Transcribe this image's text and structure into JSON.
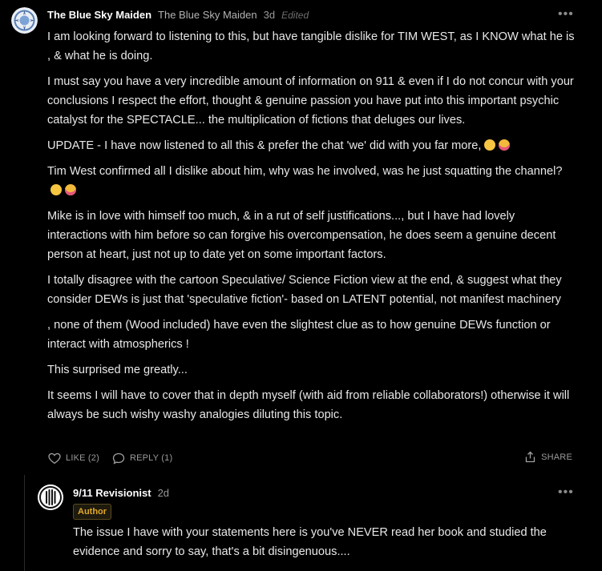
{
  "comment": {
    "author": "The Blue Sky Maiden",
    "handle": "The Blue Sky Maiden",
    "time": "3d",
    "edited": "Edited",
    "paragraphs": [
      "I am looking forward to listening to this, but have tangible dislike for TIM WEST, as I KNOW what he is , & what he is doing.",
      "I must say you have a very incredible amount of information on 911 & even if I do not concur with your conclusions I respect the effort, thought & genuine passion you have put into this important psychic catalyst for the SPECTACLE... the multiplication of fictions that deluges our lives.",
      "UPDATE - I have now listened to all this & prefer the chat 'we' did with you far more,",
      "Tim West confirmed all I dislike about him, why was he involved, was he just squatting the channel?",
      "Mike is in love with himself too much, & in a rut of self justifications..., but I have had lovely interactions with him before so can forgive his overcompensation, he does seem a genuine decent person at heart, just not up to date yet on some important factors.",
      "I totally disagree with the cartoon Speculative/ Science Fiction view at the end, & suggest what they consider DEWs is just that 'speculative fiction'- based on LATENT potential, not manifest machinery",
      ", none of them (Wood included) have even the slightest clue as to how genuine DEWs function or interact with atmospherics !",
      "This surprised me greatly...",
      "It seems I will have to cover that in depth myself (with aid from reliable collaborators!) otherwise it will always be such wishy washy analogies diluting this topic."
    ],
    "emoji": {
      "update": [
        "eye-roll-emoji",
        "tongue-out-emoji"
      ],
      "tim": [
        "thinking-emoji",
        "tongue-out-emoji"
      ]
    },
    "like_label": "LIKE (2)",
    "reply_label": "REPLY (1)",
    "share_label": "SHARE"
  },
  "reply": {
    "author": "9/11 Revisionist",
    "time": "2d",
    "badge": "Author",
    "text": "The issue I have with your statements here is you've NEVER read her book and studied the evidence and sorry to say, that's a bit disingenuous...."
  },
  "colors": {
    "background": "#000000",
    "text": "#e8e8e8",
    "muted": "#9a9a9a",
    "badge": "#e0a92a"
  }
}
